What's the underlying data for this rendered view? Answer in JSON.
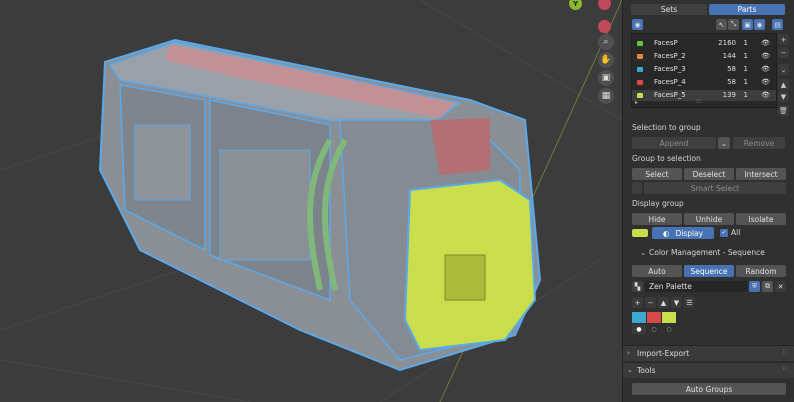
{
  "viewport": {
    "gizmo_y": "Y",
    "nav_icons": [
      "zoom-icon",
      "hand-icon",
      "camera-icon",
      "grid-icon"
    ]
  },
  "tabs": {
    "sets": "Sets",
    "parts": "Parts"
  },
  "groups": [
    {
      "name": "FacesP",
      "count": "2160",
      "on": "1",
      "color": "#5ec843"
    },
    {
      "name": "FacesP_2",
      "count": "144",
      "on": "1",
      "color": "#e8853b"
    },
    {
      "name": "FacesP_3",
      "count": "58",
      "on": "1",
      "color": "#3aa8cf"
    },
    {
      "name": "FacesP_4",
      "count": "58",
      "on": "1",
      "color": "#d84a4a"
    },
    {
      "name": "FacesP_5",
      "count": "139",
      "on": "1",
      "color": "#c9de4a"
    }
  ],
  "list_scroll": "⁝⁝⁝",
  "selection_to_group": {
    "label": "Selection to group",
    "append": "Append",
    "remove": "Remove"
  },
  "group_to_selection": {
    "label": "Group to selection",
    "select": "Select",
    "deselect": "Deselect",
    "intersect": "Intersect",
    "smart_select": "Smart Select"
  },
  "display_group": {
    "label": "Display group",
    "hide": "Hide",
    "unhide": "Unhide",
    "isolate": "Isolate",
    "display": "Display",
    "all": "All",
    "swatch_color": "#c9de4a"
  },
  "color_management": {
    "label": "Color Management - Sequence",
    "auto": "Auto",
    "sequence": "Sequence",
    "random": "Random"
  },
  "palette": {
    "name": "Zen Palette",
    "colors": [
      "#3aa8cf",
      "#d84a4a",
      "#c9de4a"
    ]
  },
  "sections": {
    "import_export": "Import-Export",
    "tools": "Tools",
    "auto_groups": "Auto Groups"
  }
}
